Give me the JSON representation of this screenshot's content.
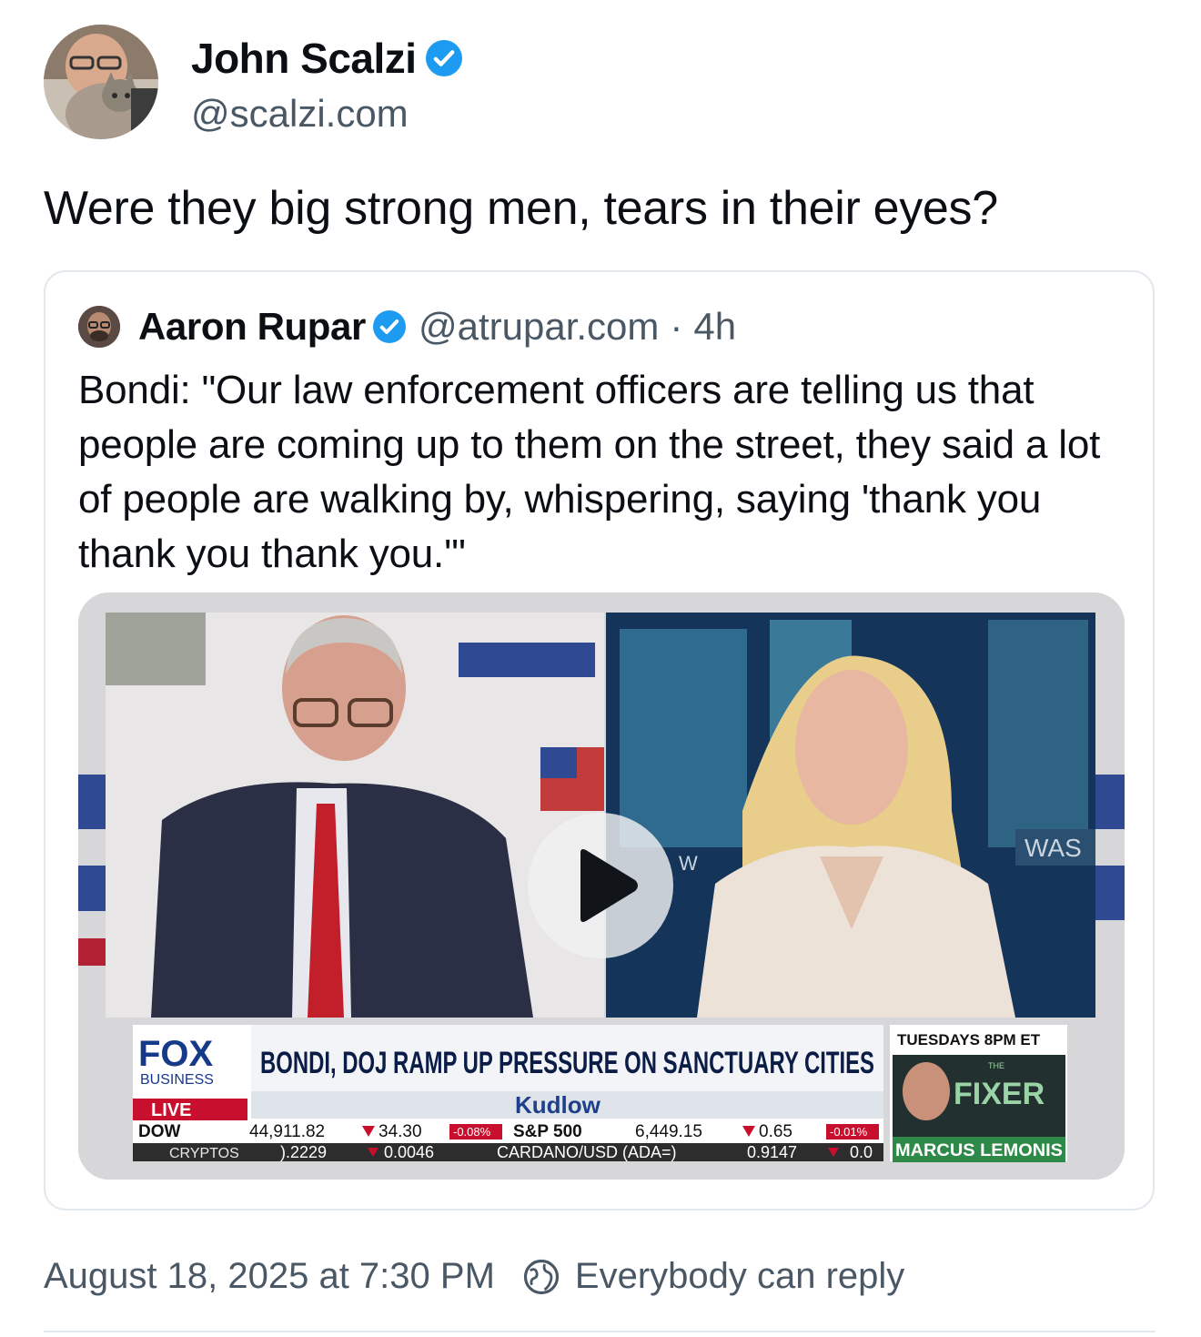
{
  "post": {
    "author_name": "John Scalzi",
    "author_handle": "@scalzi.com",
    "text": "Were they big strong men, tears in their eyes?"
  },
  "quoted_post": {
    "author_name": "Aaron Rupar",
    "author_handle": "@atrupar.com",
    "separator": "·",
    "time": "4h",
    "text": "Bondi: \"Our law enforcement officers are telling us that people are coming up to them on the street, they said a lot of people are walking by, whispering, saying 'thank you thank you thank you.'\"",
    "video": {
      "network_logo": "FOX",
      "network_sub": "BUSINESS",
      "live_label": "LIVE",
      "headline": "BONDI, DOJ RAMP UP PRESSURE ON SANCTUARY CITIES",
      "show_name": "Kudlow",
      "promo_time": "TUESDAYS 8PM ET",
      "promo_show": "FIXER",
      "promo_show_pre": "THE",
      "promo_host": "MARCUS LEMONIS",
      "backdrop_text_1": "WAS",
      "backdrop_text_2": "W",
      "ticker_row1": [
        {
          "label": "DOW",
          "value": "44,911.82",
          "change": "34.30",
          "pct": "-0.08%"
        },
        {
          "label": "S&P 500",
          "value": "6,449.15",
          "change": "0.65",
          "pct": "-0.01%"
        }
      ],
      "ticker_row2": {
        "label": "CRYPTOS",
        "value_a": ").2229",
        "change_a": "0.0046",
        "pair": "CARDANO/USD (ADA=)",
        "value_b": "0.9147",
        "change_b": "0.0"
      }
    }
  },
  "footer": {
    "timestamp": "August 18, 2025 at 7:30 PM",
    "reply_setting": "Everybody can reply"
  },
  "colors": {
    "verified": "#1d9bf0",
    "text_secondary": "#4a5866",
    "border": "#e3e8ed"
  },
  "icons": [
    "verified-badge-icon",
    "play-icon",
    "globe-icon"
  ]
}
